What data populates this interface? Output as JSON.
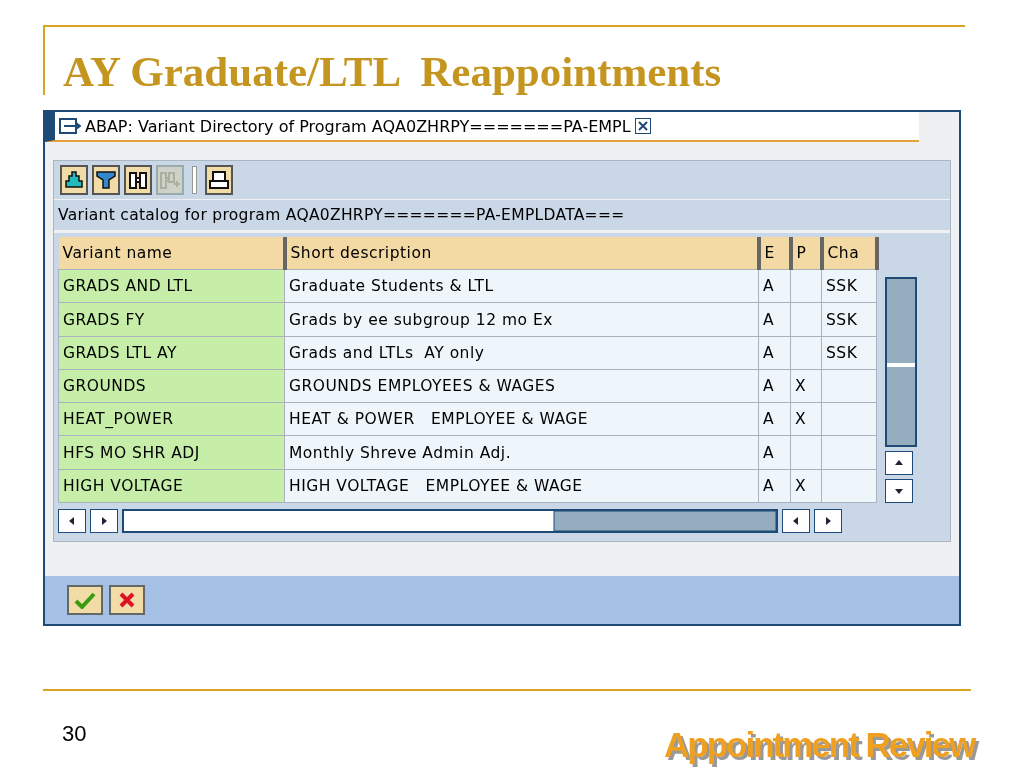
{
  "slide": {
    "title": "AY Graduate/LTL  Reappointments",
    "page_number": "30",
    "logo_text": "Appointment Review"
  },
  "window": {
    "title": "ABAP: Variant Directory of Program AQA0ZHRPY=======PA-EMPL"
  },
  "toolbar": [
    {
      "kind": "sort",
      "disabled": false
    },
    {
      "kind": "filter",
      "disabled": false
    },
    {
      "kind": "find",
      "disabled": false
    },
    {
      "kind": "find-next",
      "disabled": true
    },
    {
      "kind": "print",
      "disabled": false
    }
  ],
  "catalog_label": "Variant catalog for program AQA0ZHRPY=======PA-EMPLDATA===",
  "table": {
    "columns": [
      "Variant name",
      "Short description",
      "E",
      "P",
      "Cha"
    ],
    "rows": [
      [
        "GRADS AND LTL",
        "Graduate Students & LTL",
        "A",
        "",
        "SSK"
      ],
      [
        "GRADS FY",
        "Grads by ee subgroup 12 mo Ex",
        "A",
        "",
        "SSK"
      ],
      [
        "GRADS LTL AY",
        "Grads and LTLs  AY only",
        "A",
        "",
        "SSK"
      ],
      [
        "GROUNDS",
        "GROUNDS EMPLOYEES & WAGES",
        "A",
        "X",
        ""
      ],
      [
        "HEAT_POWER",
        "HEAT & POWER   EMPLOYEE & WAGE",
        "A",
        "X",
        ""
      ],
      [
        "HFS MO SHR ADJ",
        "Monthly Shreve Admin Adj.",
        "A",
        "",
        ""
      ],
      [
        "HIGH VOLTAGE",
        "HIGH VOLTAGE   EMPLOYEE & WAGE",
        "A",
        "X",
        ""
      ]
    ]
  },
  "footer_buttons": [
    {
      "kind": "confirm"
    },
    {
      "kind": "cancel"
    }
  ]
}
